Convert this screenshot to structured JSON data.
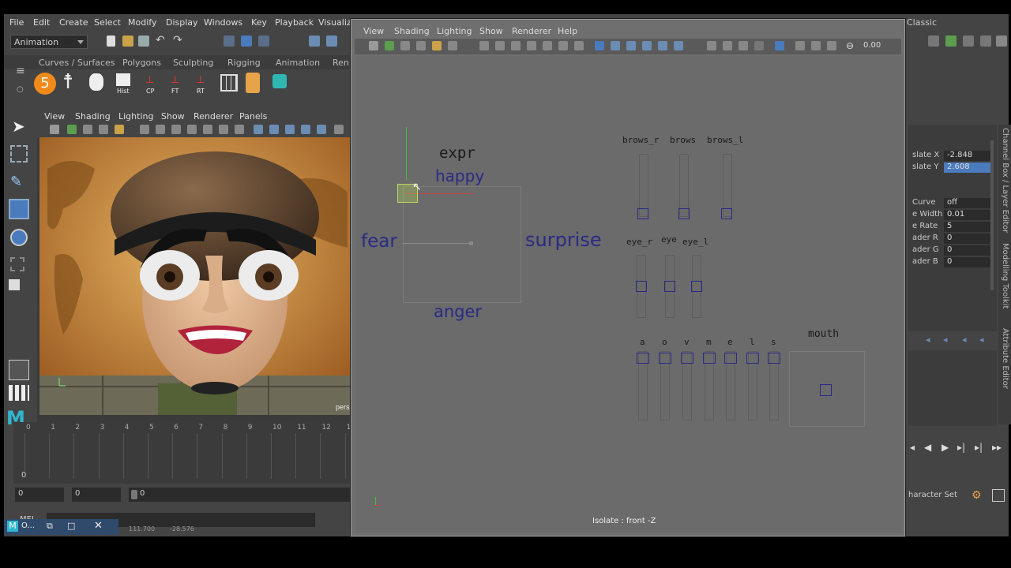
{
  "main_menu": [
    "File",
    "Edit",
    "Create",
    "Select",
    "Modify",
    "Display",
    "Windows",
    "Key",
    "Playback",
    "Visualiz"
  ],
  "workspace": {
    "label": "Classic"
  },
  "mode_dropdown": "Animation",
  "shelf_tabs": [
    "Curves / Surfaces",
    "Polygons",
    "Sculpting",
    "Rigging",
    "Animation",
    "Ren"
  ],
  "shelf_icon_labels": [
    "Hist",
    "CP",
    "FT",
    "RT"
  ],
  "shelf_badge": "5",
  "viewport": {
    "menu": [
      "View",
      "Shading",
      "Lighting",
      "Show",
      "Renderer",
      "Panels"
    ],
    "camera_label": "pers"
  },
  "timeline": {
    "ticks": [
      "0",
      "1",
      "2",
      "3",
      "4",
      "5",
      "6",
      "7",
      "8",
      "9",
      "10",
      "11",
      "12",
      "13"
    ],
    "current_frame": "0"
  },
  "range": {
    "start": "0",
    "inner_start": "0",
    "slider_start": "0"
  },
  "command_line": {
    "label": "MEL"
  },
  "status": {
    "coord_x": "111.700",
    "coord_y": "-28.576"
  },
  "taskbar": {
    "app_label": "O..."
  },
  "graph_window": {
    "menu": [
      "View",
      "Shading",
      "Lighting",
      "Show",
      "Renderer",
      "Help"
    ],
    "field_value": "0.00",
    "isolate_label": "Isolate : front -Z",
    "labels": {
      "expr": "expr",
      "happy": "happy",
      "fear": "fear",
      "surprise": "surprise",
      "anger": "anger",
      "brows_r": "brows_r",
      "brows": "brows",
      "brows_l": "brows_l",
      "eye_r": "eye_r",
      "eye": "eye",
      "eye_l": "eye_l",
      "mouth": "mouth"
    },
    "mouth_letters": [
      "a",
      "o",
      "v",
      "m",
      "e",
      "l",
      "s"
    ]
  },
  "channel_box": {
    "rows": [
      {
        "name": "slate X",
        "value": "-2.848"
      },
      {
        "name": "slate Y",
        "value": "2.608"
      },
      {
        "name": "Curve",
        "value": "off"
      },
      {
        "name": "e Width",
        "value": "0.01"
      },
      {
        "name": "e Rate",
        "value": "5"
      },
      {
        "name": "ader R",
        "value": "0"
      },
      {
        "name": "ader G",
        "value": "0"
      },
      {
        "name": "ader B",
        "value": "0"
      }
    ],
    "side_tabs": [
      "Channel Box / Layer Editor",
      "Modelling Toolkit",
      "Attribute Editor"
    ]
  },
  "charset_label": "haracter Set",
  "colors": {
    "selection": "#4a7bbd",
    "label_blue": "#2c2d7a",
    "ui_bg": "#444444",
    "window_gray": "#6b6b6b"
  }
}
